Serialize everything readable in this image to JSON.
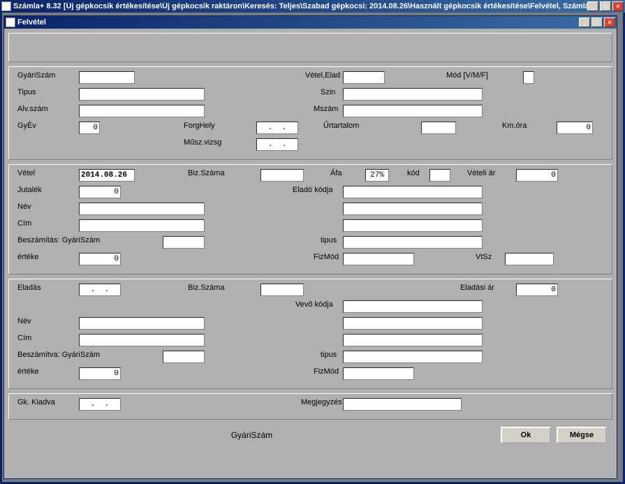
{
  "outer": {
    "title": "Számla+ 8.32   [Új gépkocsik értékesítése\\Új gépkocsik raktáron\\Keresés: Teljes\\Szabad gépkocsi: 2014.08.26\\Használt gépkocsik értékesítése\\Felvétel, Számlázás"
  },
  "child": {
    "title": "Felvétel"
  },
  "labels": {
    "gyari_szam": "GyáriSzám",
    "tipus": "Tipus",
    "alv_szam": "Alv.szám",
    "gyev": "GyÉv",
    "forg_hely": "ForgHely",
    "musz_vizsg": "Műsz.vizsg",
    "vetel_elad": "Vétel,Elad",
    "mod": "Mód [V/M/F]",
    "szin": "Szin",
    "mszam": "Mszám",
    "urtartalom": "Űrtartalom",
    "km_ora": "Km.óra",
    "vetel": "Vétel",
    "biz_szama": "Biz.Száma",
    "afa": "Áfa",
    "kod": "kód",
    "veteli_ar": "Vételi ár",
    "jutalek": "Jutalék",
    "elado_kodja": "Eladó kódja",
    "nev": "Név",
    "cim": "Cím",
    "beszamitas_gyari": "Beszámítás: GyáriSzám",
    "beszamitva_gyari": "Beszámítva: GyáriSzám",
    "tipus2": "tipus",
    "erteke": "értéke",
    "fizmod": "FizMód",
    "vtsz": "VtSz",
    "eladas": "Eladás",
    "eladasi_ar": "Eladási ár",
    "vevo_kodja": "Vevő kódja",
    "gk_kiadva": "Gk. Kiadva",
    "megjegyzes": "Megjegyzés"
  },
  "values": {
    "gyev": "0",
    "forg_hely": "  .  .  ",
    "musz_vizsg": "  .  .  ",
    "km_ora": "0",
    "vetel_date": "2014.08.26",
    "afa_pct": "27%",
    "veteli_ar": "0",
    "jutalek": "0",
    "beszamitas_erteke": "0",
    "eladas_date": "  .  .  ",
    "eladasi_ar": "0",
    "beszamitva_erteke": "0",
    "gk_kiadva_date": "  .  .  "
  },
  "footer": {
    "status": "GyáriSzám",
    "ok": "Ok",
    "cancel": "Mégse"
  }
}
